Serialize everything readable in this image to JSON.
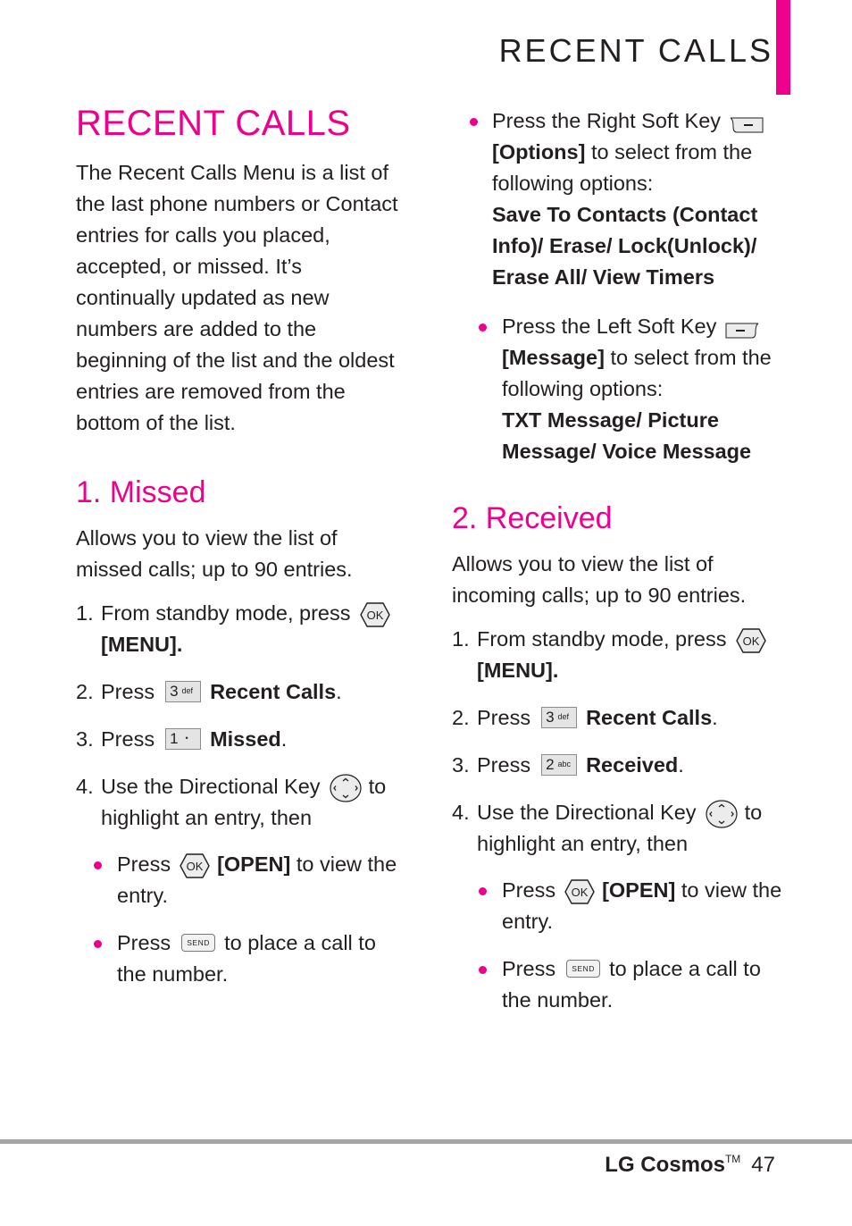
{
  "header": {
    "running_title": "RECENT CALLS"
  },
  "accent_color": "#ec008c",
  "intro": {
    "title": "RECENT CALLS",
    "text": "The Recent Calls Menu is a list of the last phone numbers or Contact entries for calls you placed, accepted, or missed. It’s continually updated as new numbers are added to the beginning of the list and the oldest entries are removed from the bottom of the list."
  },
  "missed": {
    "title": "1. Missed",
    "desc": "Allows you to view the list of missed calls; up to 90 entries.",
    "steps": [
      {
        "num": "1.",
        "pre": "From standby mode, press",
        "icon": "ok-key-icon",
        "post": "[MENU]."
      },
      {
        "num": "2.",
        "pre": "Press",
        "icon": "key-3-def-icon",
        "key_main": "3",
        "key_sub": "def",
        "label": "Recent Calls",
        "post": "."
      },
      {
        "num": "3.",
        "pre": "Press",
        "icon": "key-1-voicemail-icon",
        "key_main": "1",
        "key_sub": "•",
        "label": "Missed",
        "post": "."
      },
      {
        "num": "4.",
        "pre": "Use the Directional Key",
        "icon": "directional-key-icon",
        "post": "to highlight an entry, then"
      }
    ],
    "bullets": [
      {
        "pre": "Press",
        "icon": "ok-key-icon",
        "label": "[OPEN]",
        "post": "to  view the entry."
      },
      {
        "pre": "Press",
        "icon": "send-key-icon",
        "key_text": "SEND",
        "post": "to place a call to the number."
      }
    ]
  },
  "right_soft_key": {
    "pre": "Press the Right Soft Key",
    "icon": "right-soft-key-icon",
    "label": "[Options]",
    "post": "to select from the following options:",
    "options": "Save To Contacts (Contact Info)/ Erase/ Lock(Unlock)/ Erase All/ View Timers"
  },
  "left_soft_key": {
    "pre": "Press the Left Soft Key",
    "icon": "left-soft-key-icon",
    "label": "[Message]",
    "post": "to select from the following options:",
    "options": "TXT Message/ Picture Message/ Voice Message"
  },
  "received": {
    "title": "2. Received",
    "desc": "Allows you to view the list of incoming calls; up to 90 entries.",
    "steps": [
      {
        "num": "1.",
        "pre": "From standby mode, press",
        "icon": "ok-key-icon",
        "post": "[MENU]."
      },
      {
        "num": "2.",
        "pre": "Press",
        "icon": "key-3-def-icon",
        "key_main": "3",
        "key_sub": "def",
        "label": "Recent Calls",
        "post": "."
      },
      {
        "num": "3.",
        "pre": "Press",
        "icon": "key-2-abc-icon",
        "key_main": "2",
        "key_sub": "abc",
        "label": "Received",
        "post": "."
      },
      {
        "num": "4.",
        "pre": "Use the Directional Key",
        "icon": "directional-key-icon",
        "post": "to highlight an entry, then"
      }
    ],
    "bullets": [
      {
        "pre": "Press",
        "icon": "ok-key-icon",
        "label": "[OPEN]",
        "post": "to view the entry."
      },
      {
        "pre": "Press",
        "icon": "send-key-icon",
        "key_text": "SEND",
        "post": "to place a call to the number."
      }
    ]
  },
  "footer": {
    "brand": "LG Cosmos",
    "trademark": "TM",
    "page_number": "47"
  }
}
